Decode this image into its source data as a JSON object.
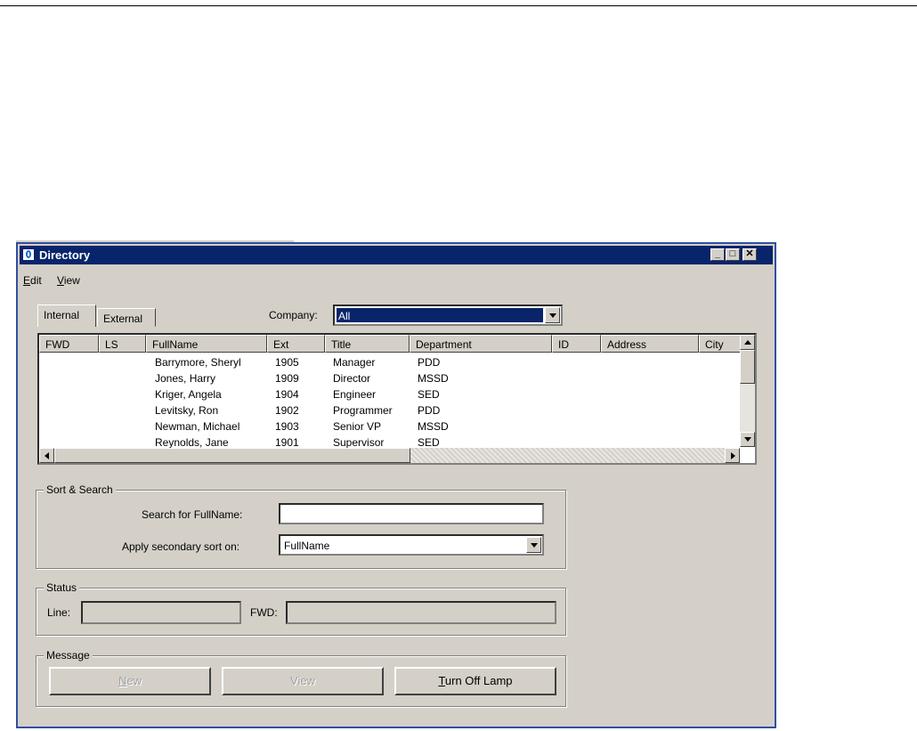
{
  "window": {
    "title": "Directory"
  },
  "menu": [
    {
      "label": "Edit",
      "accel": "E",
      "rest": "dit"
    },
    {
      "label": "View",
      "accel": "V",
      "rest": "iew"
    }
  ],
  "tabs": [
    {
      "label": "Internal"
    },
    {
      "label": "External"
    }
  ],
  "company": {
    "label": "Company:",
    "value": "All"
  },
  "grid": {
    "columns": [
      "FWD",
      "LS",
      "FullName",
      "Ext",
      "Title",
      "Department",
      "ID",
      "Address",
      "City"
    ],
    "rows": [
      [
        "",
        "",
        "Barrymore, Sheryl",
        "1905",
        "Manager",
        "PDD",
        "",
        "",
        ""
      ],
      [
        "",
        "",
        "Jones, Harry",
        "1909",
        "Director",
        "MSSD",
        "",
        "",
        ""
      ],
      [
        "",
        "",
        "Kriger, Angela",
        "1904",
        "Engineer",
        "SED",
        "",
        "",
        ""
      ],
      [
        "",
        "",
        "Levitsky, Ron",
        "1902",
        "Programmer",
        "PDD",
        "",
        "",
        ""
      ],
      [
        "",
        "",
        "Newman, Michael",
        "1903",
        "Senior VP",
        "MSSD",
        "",
        "",
        ""
      ],
      [
        "",
        "",
        "Reynolds, Jane",
        "1901",
        "Supervisor",
        "SED",
        "",
        "",
        ""
      ]
    ]
  },
  "sort_search": {
    "legend": "Sort & Search",
    "search_label": "Search for FullName:",
    "search_value": "",
    "sort_label": "Apply secondary sort on:",
    "sort_value": "FullName"
  },
  "status": {
    "legend": "Status",
    "line_label": "Line:",
    "line_value": "",
    "fwd_label": "FWD:",
    "fwd_value": ""
  },
  "message": {
    "legend": "Message",
    "buttons": [
      {
        "label": "New",
        "accel": "N",
        "rest": "ew",
        "enabled": false
      },
      {
        "label": "View",
        "accel": "V",
        "rest": "iew",
        "enabled": false
      },
      {
        "label": "Turn Off Lamp",
        "accel": "T",
        "rest": "urn Off Lamp",
        "enabled": true
      }
    ]
  },
  "colors": {
    "titlebar": "#08246b",
    "face": "#d4d0c8",
    "selection": "#0a246a"
  }
}
